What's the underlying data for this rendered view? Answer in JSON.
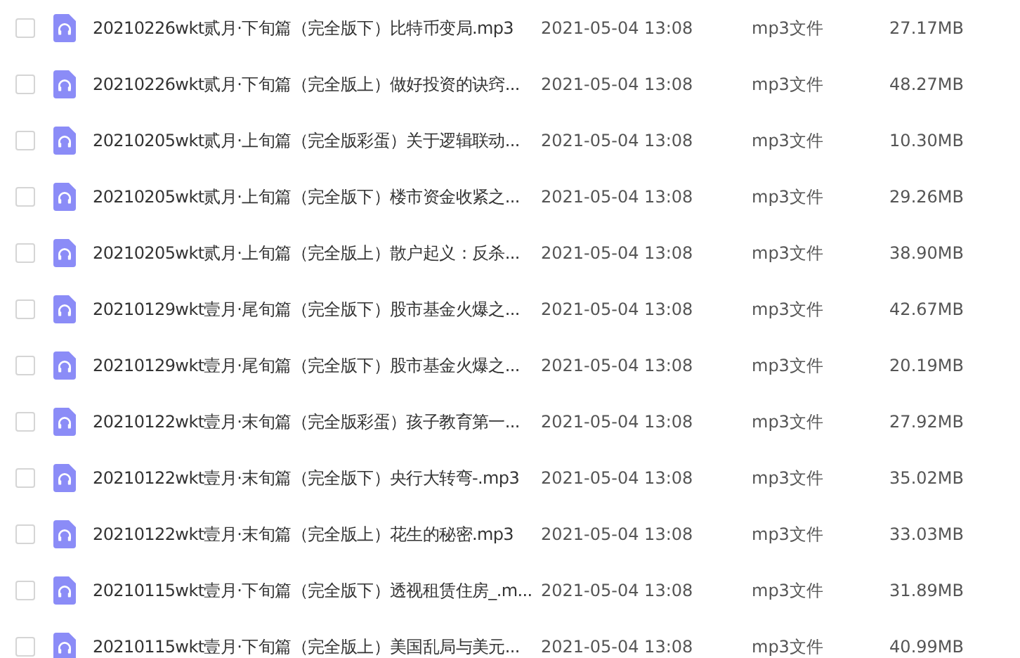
{
  "files": [
    {
      "name": "20210226wkt贰月·下旬篇（完全版下）比特币变局.mp3",
      "modified": "2021-05-04 13:08",
      "type": "mp3文件",
      "size": "27.17MB",
      "checked": false
    },
    {
      "name": "20210226wkt贰月·下旬篇（完全版上）做好投资的诀窍...",
      "modified": "2021-05-04 13:08",
      "type": "mp3文件",
      "size": "48.27MB",
      "checked": false
    },
    {
      "name": "20210205wkt贰月·上旬篇（完全版彩蛋）关于逻辑联动...",
      "modified": "2021-05-04 13:08",
      "type": "mp3文件",
      "size": "10.30MB",
      "checked": false
    },
    {
      "name": "20210205wkt贰月·上旬篇（完全版下）楼市资金收紧之...",
      "modified": "2021-05-04 13:08",
      "type": "mp3文件",
      "size": "29.26MB",
      "checked": false
    },
    {
      "name": "20210205wkt贰月·上旬篇（完全版上）散户起义：反杀...",
      "modified": "2021-05-04 13:08",
      "type": "mp3文件",
      "size": "38.90MB",
      "checked": false
    },
    {
      "name": "20210129wkt壹月·尾旬篇（完全版下）股市基金火爆之...",
      "modified": "2021-05-04 13:08",
      "type": "mp3文件",
      "size": "42.67MB",
      "checked": false
    },
    {
      "name": "20210129wkt壹月·尾旬篇（完全版下）股市基金火爆之...",
      "modified": "2021-05-04 13:08",
      "type": "mp3文件",
      "size": "20.19MB",
      "checked": false
    },
    {
      "name": "20210122wkt壹月·末旬篇（完全版彩蛋）孩子教育第一...",
      "modified": "2021-05-04 13:08",
      "type": "mp3文件",
      "size": "27.92MB",
      "checked": false
    },
    {
      "name": "20210122wkt壹月·末旬篇（完全版下）央行大转弯-.mp3",
      "modified": "2021-05-04 13:08",
      "type": "mp3文件",
      "size": "35.02MB",
      "checked": false
    },
    {
      "name": "20210122wkt壹月·末旬篇（完全版上）花生的秘密.mp3",
      "modified": "2021-05-04 13:08",
      "type": "mp3文件",
      "size": "33.03MB",
      "checked": false
    },
    {
      "name": "20210115wkt壹月·下旬篇（完全版下）透视租赁住房_.m...",
      "modified": "2021-05-04 13:08",
      "type": "mp3文件",
      "size": "31.89MB",
      "checked": false
    },
    {
      "name": "20210115wkt壹月·下旬篇（完全版上）美国乱局与美元...",
      "modified": "2021-05-04 13:08",
      "type": "mp3文件",
      "size": "40.99MB",
      "checked": false
    }
  ]
}
